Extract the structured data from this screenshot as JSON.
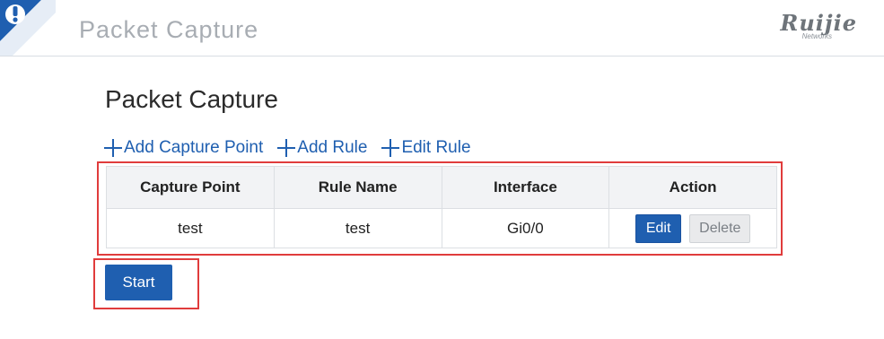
{
  "header": {
    "title": "Packet Capture",
    "brand_name": "Ruijie",
    "brand_sub": "Networks",
    "badge_glyph": "!",
    "badge_color": "#1f5fb0"
  },
  "main": {
    "title": "Packet Capture",
    "toolbar": [
      {
        "label": "Add Capture Point",
        "icon": "plus-icon"
      },
      {
        "label": "Add Rule",
        "icon": "plus-icon"
      },
      {
        "label": "Edit Rule",
        "icon": "plus-icon"
      }
    ],
    "table": {
      "columns": [
        "Capture Point",
        "Rule Name",
        "Interface",
        "Action"
      ],
      "rows": [
        {
          "capture_point": "test",
          "rule_name": "test",
          "interface": "Gi0/0",
          "edit_label": "Edit",
          "delete_label": "Delete"
        }
      ]
    },
    "start_label": "Start"
  },
  "colors": {
    "accent": "#1f5fb0",
    "highlight": "#e03c3c"
  }
}
